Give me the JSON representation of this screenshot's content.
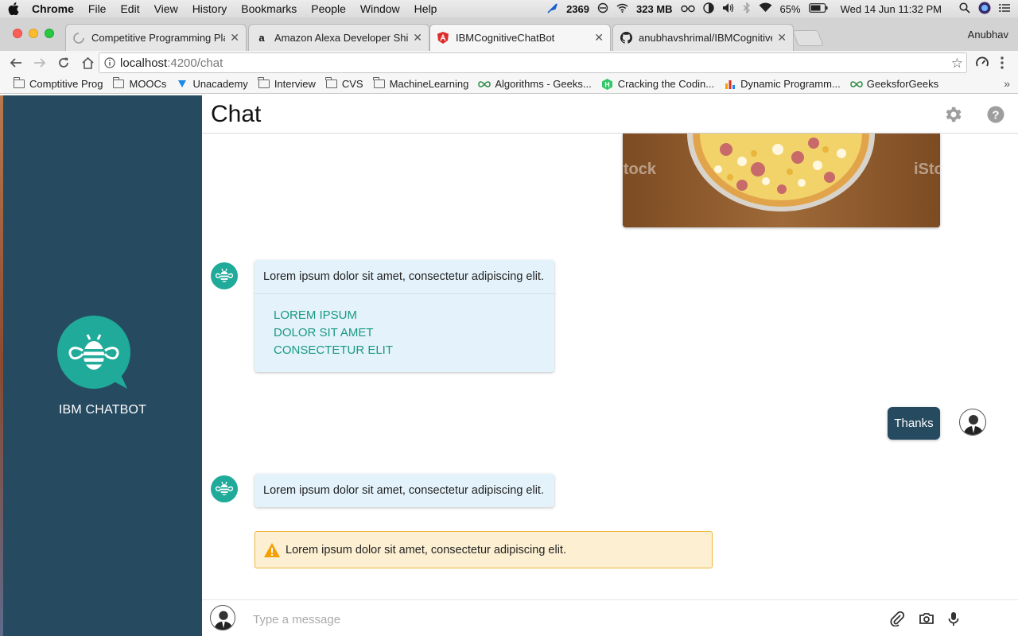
{
  "menubar": {
    "app_name": "Chrome",
    "items": [
      "File",
      "Edit",
      "View",
      "History",
      "Bookmarks",
      "People",
      "Window",
      "Help"
    ],
    "status": {
      "counter": "2369",
      "memory": "323 MB",
      "battery": "65%",
      "datetime": "Wed 14 Jun  11:32 PM"
    }
  },
  "tabs": [
    {
      "title": "Competitive Programming Play",
      "icon": "loading-icon"
    },
    {
      "title": "Amazon Alexa Developer Shirt",
      "icon": "amazon-icon"
    },
    {
      "title": "IBMCognitiveChatBot",
      "icon": "angular-icon",
      "active": true
    },
    {
      "title": "anubhavshrimal/IBMCognitiveC",
      "icon": "github-icon"
    }
  ],
  "profile_name": "Anubhav",
  "address": {
    "host": "localhost",
    "rest": ":4200/chat"
  },
  "bookmarks": [
    {
      "label": "Comptitive Prog",
      "icon": "folder-icon"
    },
    {
      "label": "MOOCs",
      "icon": "folder-icon"
    },
    {
      "label": "Unacademy",
      "icon": "unacademy-icon"
    },
    {
      "label": "Interview",
      "icon": "folder-icon"
    },
    {
      "label": "CVS",
      "icon": "folder-icon"
    },
    {
      "label": "MachineLearning",
      "icon": "folder-icon"
    },
    {
      "label": "Algorithms - Geeks...",
      "icon": "geeksforgeeks-icon"
    },
    {
      "label": "Cracking the Codin...",
      "icon": "hackerrank-icon"
    },
    {
      "label": "Dynamic Programm...",
      "icon": "chart-icon"
    },
    {
      "label": "GeeksforGeeks",
      "icon": "geeksforgeeks-icon"
    }
  ],
  "sidebar": {
    "brand": "IBM CHATBOT"
  },
  "header": {
    "title": "Chat"
  },
  "image_watermark": "iStock",
  "messages": {
    "bot1_text": "Lorem ipsum dolor sit amet, consectetur adipiscing elit.",
    "bot1_links": [
      "LOREM IPSUM",
      "DOLOR SIT AMET",
      "CONSECTETUR ELIT"
    ],
    "user_text": "Thanks",
    "bot2_text": "Lorem ipsum dolor sit amet, consectetur adipiscing elit.",
    "warning_text": "Lorem ipsum dolor sit amet, consectetur adipiscing elit."
  },
  "composer": {
    "placeholder": "Type a message"
  },
  "colors": {
    "sidebar_bg": "#264a60",
    "bot_accent": "#1faa9a",
    "bubble_bg": "#e4f3fb",
    "link": "#1a9884",
    "warning_bg": "#fdf0d2",
    "warning_border": "#f0b43b"
  }
}
